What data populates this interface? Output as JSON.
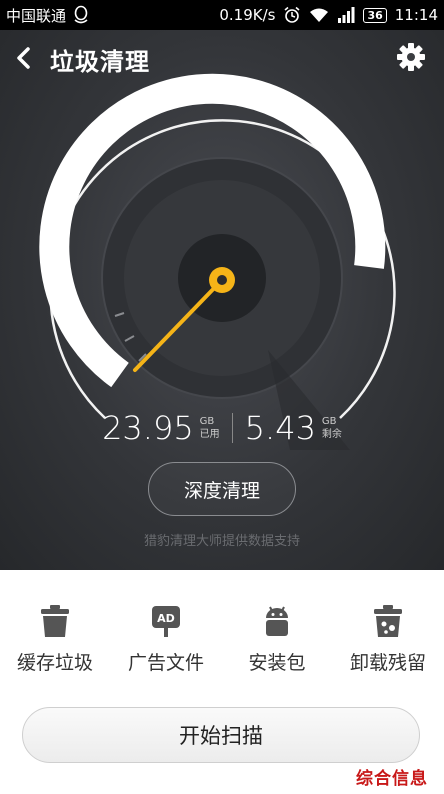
{
  "status_bar": {
    "carrier": "中国联通",
    "speed": "0.19K/s",
    "battery": "36",
    "time": "11:14",
    "icons": [
      "qq-icon",
      "alarm-icon",
      "wifi-icon",
      "signal-icon",
      "battery-icon"
    ]
  },
  "header": {
    "title": "垃圾清理",
    "back_icon": "chevron-left-icon",
    "settings_icon": "gear-icon"
  },
  "gauge": {
    "used_value": "23.95",
    "used_unit": "GB",
    "used_label": "已用",
    "free_value": "5.43",
    "free_unit": "GB",
    "free_label": "剩余"
  },
  "deep_clean_button": "深度清理",
  "credit": "猎豹清理大师提供数据支持",
  "categories": [
    {
      "label": "缓存垃圾",
      "icon": "trash-icon"
    },
    {
      "label": "广告文件",
      "icon": "ad-sign-icon"
    },
    {
      "label": "安装包",
      "icon": "android-icon"
    },
    {
      "label": "卸载残留",
      "icon": "residue-trash-icon"
    }
  ],
  "start_button": "开始扫描",
  "watermark": "综合信息",
  "colors": {
    "accent": "#f5b418",
    "dark_bg": "#333539",
    "watermark": "#c81818"
  }
}
